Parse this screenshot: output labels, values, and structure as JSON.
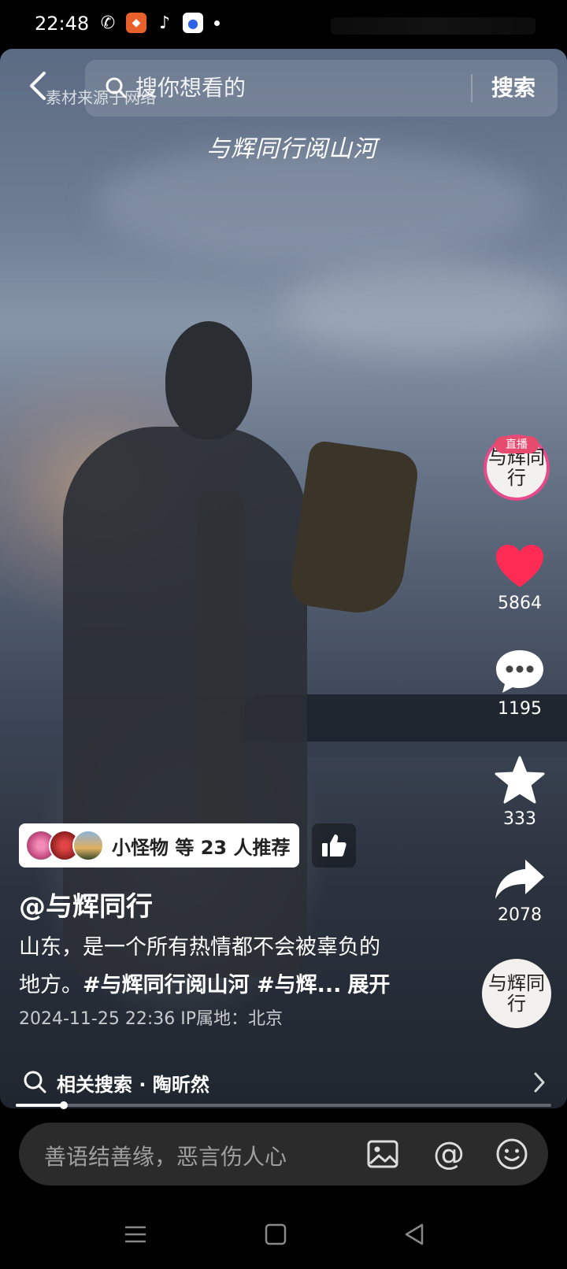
{
  "status_bar": {
    "time": "22:48",
    "icons": [
      "wechat-icon",
      "app-icon",
      "tiktok-icon",
      "baidu-icon"
    ]
  },
  "header": {
    "source_note": "素材来源于网络",
    "search_placeholder": "搜你想看的",
    "search_button": "搜索"
  },
  "video": {
    "watermark": "与辉同行阅山河"
  },
  "right_rail": {
    "live_badge": "直播",
    "avatar_text": "与辉同行",
    "likes": "5864",
    "comments": "1195",
    "favorites": "333",
    "shares": "2078"
  },
  "recommend": {
    "text": "小怪物 等 23 人推荐"
  },
  "post": {
    "author": "@与辉同行",
    "desc_line1": "山东，是一个所有热情都不会被辜负的",
    "desc_line2_plain": "地方。",
    "desc_tags": "#与辉同行阅山河 #与辉...",
    "expand": "展开",
    "meta": "2024-11-25 22:36  IP属地：北京"
  },
  "related": {
    "text": "相关搜索 · 陶昕然"
  },
  "progress": {
    "fraction": 0.09
  },
  "comment_bar": {
    "placeholder": "善语结善缘，恶言伤人心",
    "at_symbol": "@"
  },
  "colors": {
    "like": "#fe2c55",
    "live_ring": "#e64a8a"
  }
}
